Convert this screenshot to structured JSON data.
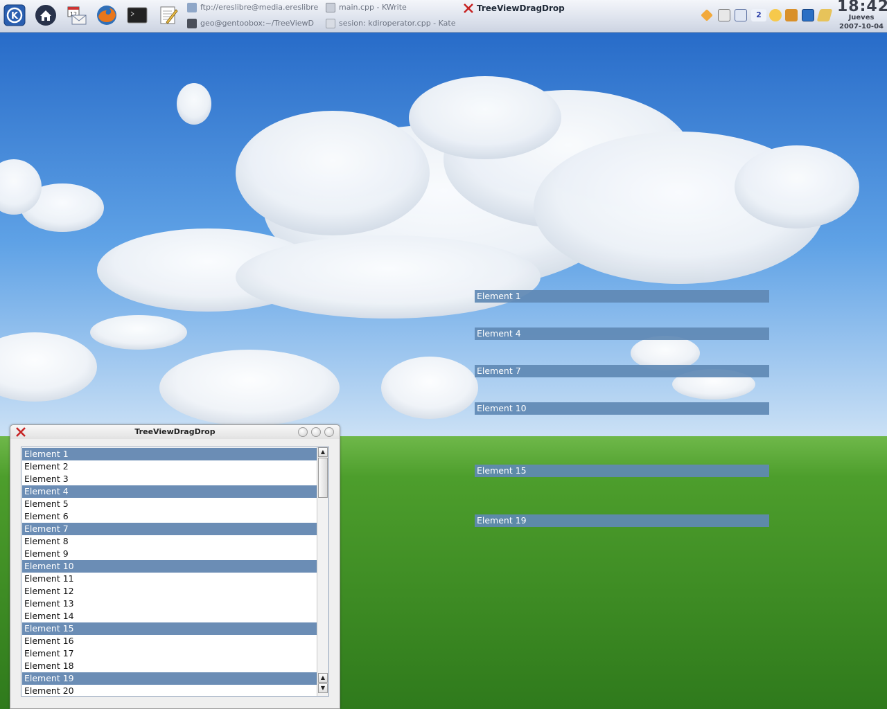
{
  "panel": {
    "launchers": [
      {
        "name": "kde-menu-icon"
      },
      {
        "name": "home-icon"
      },
      {
        "name": "mail-calendar-icon"
      },
      {
        "name": "firefox-icon"
      },
      {
        "name": "terminal-icon"
      },
      {
        "name": "text-editor-icon"
      }
    ],
    "tasks": [
      {
        "label": "ftp://ereslibre@media.ereslibre",
        "icon": "ftp-icon"
      },
      {
        "label": "main.cpp - KWrite",
        "icon": "kwrite-icon"
      },
      {
        "label": "geo@gentoobox:~/TreeViewD",
        "icon": "konsole-icon"
      },
      {
        "label": "sesion: kdiroperator.cpp - Kate",
        "icon": "kate-icon"
      }
    ],
    "active_task": {
      "label": "TreeViewDragDrop",
      "icon": "app-x-icon"
    },
    "tray_icons": [
      "pencil-icon",
      "kalendar-icon",
      "contacts-icon",
      "desktop-pager-icon",
      "power-icon",
      "folder-icon",
      "kde-icon",
      "mail-icon"
    ],
    "pager_badge": "2",
    "clock": {
      "time": "18:42",
      "day": "Jueves",
      "date": "2007-10-04"
    }
  },
  "drag_ghost": {
    "items": [
      "Element 1",
      "Element 4",
      "Element 7",
      "Element 10",
      "Element 15",
      "Element 19"
    ]
  },
  "window": {
    "title": "TreeViewDragDrop",
    "list": {
      "items": [
        {
          "label": "Element 1",
          "selected": true
        },
        {
          "label": "Element 2",
          "selected": false
        },
        {
          "label": "Element 3",
          "selected": false
        },
        {
          "label": "Element 4",
          "selected": true
        },
        {
          "label": "Element 5",
          "selected": false
        },
        {
          "label": "Element 6",
          "selected": false
        },
        {
          "label": "Element 7",
          "selected": true
        },
        {
          "label": "Element 8",
          "selected": false
        },
        {
          "label": "Element 9",
          "selected": false
        },
        {
          "label": "Element 10",
          "selected": true
        },
        {
          "label": "Element 11",
          "selected": false
        },
        {
          "label": "Element 12",
          "selected": false
        },
        {
          "label": "Element 13",
          "selected": false
        },
        {
          "label": "Element 14",
          "selected": false
        },
        {
          "label": "Element 15",
          "selected": true
        },
        {
          "label": "Element 16",
          "selected": false
        },
        {
          "label": "Element 17",
          "selected": false
        },
        {
          "label": "Element 18",
          "selected": false
        },
        {
          "label": "Element 19",
          "selected": true
        },
        {
          "label": "Element 20",
          "selected": false
        }
      ]
    }
  },
  "colors": {
    "selection": "#6b8db5",
    "sky": "#3f86d8",
    "grass": "#3f8c22"
  }
}
